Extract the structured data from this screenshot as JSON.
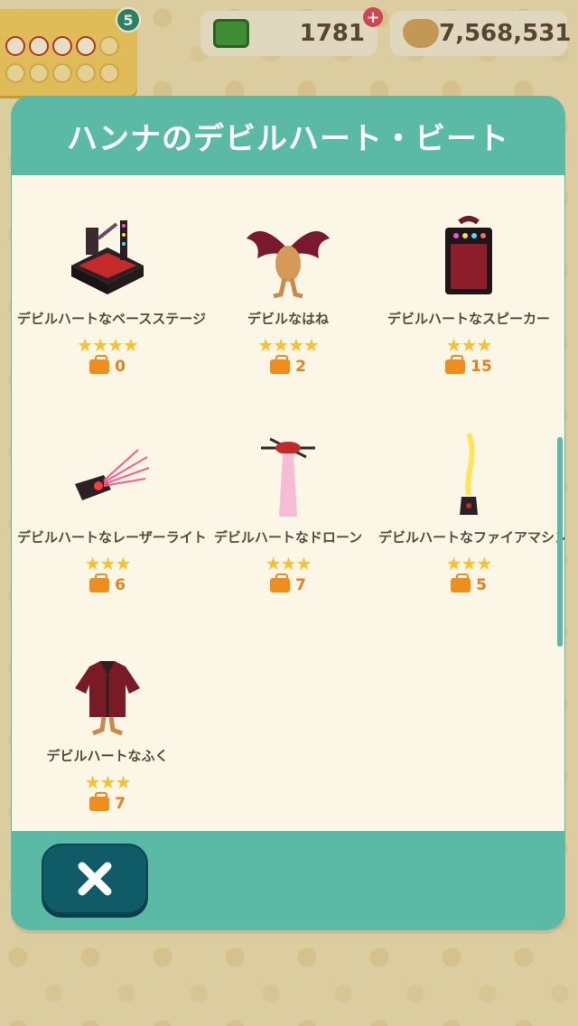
{
  "hud": {
    "badge_count": "5",
    "tickets": "1781",
    "bells": "7,568,531"
  },
  "dialog": {
    "title": "ハンナのデビルハート・ビート",
    "items": [
      {
        "name": "デビルハートなベースステージ",
        "stars": "★★★★",
        "count": "0",
        "icon": "bass-stage-icon"
      },
      {
        "name": "デビルなはね",
        "stars": "★★★★",
        "count": "2",
        "icon": "devil-wings-icon"
      },
      {
        "name": "デビルハートなスピーカー",
        "stars": "★★★",
        "count": "15",
        "icon": "speaker-icon"
      },
      {
        "name": "デビルハートなレーザーライト",
        "stars": "★★★",
        "count": "6",
        "icon": "laser-light-icon"
      },
      {
        "name": "デビルハートなドローン",
        "stars": "★★★",
        "count": "7",
        "icon": "drone-icon"
      },
      {
        "name": "デビルハートなファイアマシン",
        "stars": "★★★",
        "count": "5",
        "icon": "fire-machine-icon"
      },
      {
        "name": "デビルハートなふく",
        "stars": "★★★",
        "count": "7",
        "icon": "outfit-icon"
      }
    ]
  },
  "colors": {
    "teal": "#5bbaa6",
    "close_button": "#0f5b67",
    "text": "#5b4a3a",
    "star": "#f6c232",
    "count": "#e8801e"
  }
}
